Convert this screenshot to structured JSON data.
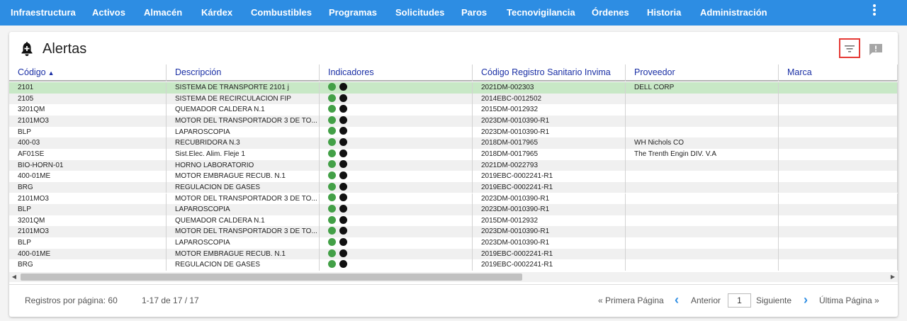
{
  "nav": {
    "items": [
      "Infraestructura",
      "Activos",
      "Almacén",
      "Kárdex",
      "Combustibles",
      "Programas",
      "Solicitudes",
      "Paros",
      "Tecnovigilancia",
      "Órdenes",
      "Historia",
      "Administración"
    ],
    "more_icon": "more-vert-icon"
  },
  "page": {
    "title": "Alertas",
    "title_icon": "bell-icon"
  },
  "table": {
    "columns": [
      "Código",
      "Descripción",
      "Indicadores",
      "Código Registro Sanitario Invima",
      "Proveedor",
      "Marca"
    ],
    "sort_icon": "▲",
    "rows": [
      {
        "codigo": "2101",
        "descripcion": "SISTEMA DE TRANSPORTE 2101 j",
        "registro": "2021DM-002303",
        "proveedor": "DELL CORP",
        "marca": ""
      },
      {
        "codigo": "2105",
        "descripcion": "SISTEMA DE RECIRCULACION FIP",
        "registro": "2014EBC-0012502",
        "proveedor": "",
        "marca": ""
      },
      {
        "codigo": "3201QM",
        "descripcion": "QUEMADOR CALDERA N.1",
        "registro": "2015DM-0012932",
        "proveedor": "",
        "marca": ""
      },
      {
        "codigo": "2101MO3",
        "descripcion": "MOTOR DEL TRANSPORTADOR 3 DE TO...",
        "registro": "2023DM-0010390-R1",
        "proveedor": "",
        "marca": ""
      },
      {
        "codigo": "BLP",
        "descripcion": "LAPAROSCOPIA",
        "registro": "2023DM-0010390-R1",
        "proveedor": "",
        "marca": ""
      },
      {
        "codigo": "400-03",
        "descripcion": "RECUBRIDORA N.3",
        "registro": "2018DM-0017965",
        "proveedor": "WH Nichols CO",
        "marca": ""
      },
      {
        "codigo": "AF01SE",
        "descripcion": "Sist.Elec. Alim. Fleje 1",
        "registro": "2018DM-0017965",
        "proveedor": "The Trenth Engin DIV. V.A",
        "marca": ""
      },
      {
        "codigo": "BIO-HORN-01",
        "descripcion": "HORNO LABORATORIO",
        "registro": "2021DM-0022793",
        "proveedor": "",
        "marca": ""
      },
      {
        "codigo": "400-01ME",
        "descripcion": "MOTOR EMBRAGUE RECUB. N.1",
        "registro": "2019EBC-0002241-R1",
        "proveedor": "",
        "marca": ""
      },
      {
        "codigo": "BRG",
        "descripcion": "REGULACION DE GASES",
        "registro": "2019EBC-0002241-R1",
        "proveedor": "",
        "marca": ""
      },
      {
        "codigo": "2101MO3",
        "descripcion": "MOTOR DEL TRANSPORTADOR 3 DE TO...",
        "registro": "2023DM-0010390-R1",
        "proveedor": "",
        "marca": ""
      },
      {
        "codigo": "BLP",
        "descripcion": "LAPAROSCOPIA",
        "registro": "2023DM-0010390-R1",
        "proveedor": "",
        "marca": ""
      },
      {
        "codigo": "3201QM",
        "descripcion": "QUEMADOR CALDERA N.1",
        "registro": "2015DM-0012932",
        "proveedor": "",
        "marca": ""
      },
      {
        "codigo": "2101MO3",
        "descripcion": "MOTOR DEL TRANSPORTADOR 3 DE TO...",
        "registro": "2023DM-0010390-R1",
        "proveedor": "",
        "marca": ""
      },
      {
        "codigo": "BLP",
        "descripcion": "LAPAROSCOPIA",
        "registro": "2023DM-0010390-R1",
        "proveedor": "",
        "marca": ""
      },
      {
        "codigo": "400-01ME",
        "descripcion": "MOTOR EMBRAGUE RECUB. N.1",
        "registro": "2019EBC-0002241-R1",
        "proveedor": "",
        "marca": ""
      },
      {
        "codigo": "BRG",
        "descripcion": "REGULACION DE GASES",
        "registro": "2019EBC-0002241-R1",
        "proveedor": "",
        "marca": ""
      }
    ],
    "indicator_colors": [
      "#43a047",
      "#111111"
    ]
  },
  "footer": {
    "per_page": "Registros por página: 60",
    "range": "1-17 de 17 / 17",
    "first": "« Primera Página",
    "prev": "Anterior",
    "page": "1",
    "next": "Siguiente",
    "last": "Última Página »"
  },
  "colors": {
    "nav_bg": "#2d8de3",
    "header_text": "#1a2fa5",
    "selected_row": "#c8e8c6",
    "filter_border": "#e53935"
  }
}
